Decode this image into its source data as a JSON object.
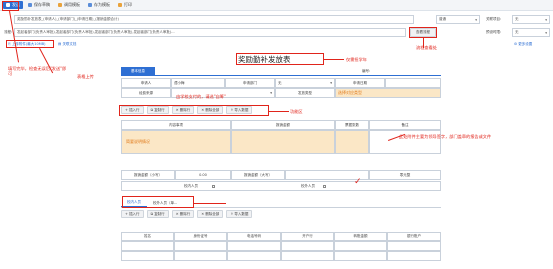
{
  "toolbar": {
    "submit": "发送",
    "save_draft": "保存草稿",
    "template": "调用模板",
    "save_template": "存为模板",
    "print": "打印"
  },
  "header": {
    "title_value": "奖励勤补发放表_(申请人)_(申请部门)_(申请日期)_(报销金额合计)",
    "urgency_label": "",
    "urgency_value": "普通",
    "related_label": "关联项目:",
    "related_value": "无",
    "process_label": "流程:",
    "process_value": "发起者部门(负责人审批),发起者部门(负责人审批),发起者部门(负责人审批),发起者部门(负责人审批)...",
    "view_process": "查看流程",
    "deadline_label": "预设时限:",
    "deadline_value": "无",
    "upload_attachment": "上传附件(最大10MB)",
    "related_doc": "关联文档",
    "more_settings": "更多设置"
  },
  "form": {
    "title": "奖励勤补发放表",
    "basic_info": "基本信息",
    "number_label": "编号:",
    "applicant_label": "申请人",
    "applicant_value": "谭小梅",
    "dept_label": "申请部门",
    "dept_value": "无",
    "date_label": "申请日期",
    "fund_source_label": "经费来源",
    "fund_type_label": "发放类型",
    "fund_type_value": "选择对应类型",
    "table_buttons": [
      "插入行",
      "复制行",
      "删除行",
      "删除全部",
      "导入数据"
    ],
    "content_col": "内容事项",
    "amount_col": "报销金额",
    "invoice_col": "票据张数",
    "remarks_col": "备注",
    "content_hint": "简要说明情况",
    "total_small_label": "报销金额（小写）",
    "total_small_value": "0.00",
    "total_big_label": "报销金额（大写）",
    "total_big_value": "零元整",
    "in_school_label": "校内人员",
    "out_school_label": "校外人员",
    "tabs": [
      "校内人员",
      "校外人员（单..."
    ],
    "people_buttons": [
      "插入行",
      "复制行",
      "删除行",
      "删除全部",
      "导入数据"
    ],
    "people_cols": [
      "姓名",
      "身份证号",
      "电话号码",
      "开户行",
      "转账金额",
      "银行账户"
    ]
  },
  "annotations": {
    "fill_complete": "填写完毕，检查无误后\"发送\"即可",
    "attachment_upload": "表格上传",
    "process_view": "流程查看处",
    "title_fill": "仅需担学年",
    "fund_source_hint": "由学校支付的，请选\"自筹\"",
    "function_area": "功能区",
    "remarks_hint": "此处附件主要为领导签字，部门盖章的报告或文件"
  },
  "colors": {
    "accent": "#2e6fd3",
    "annotation": "#e0241b",
    "highlight": "#fbe7c6"
  }
}
